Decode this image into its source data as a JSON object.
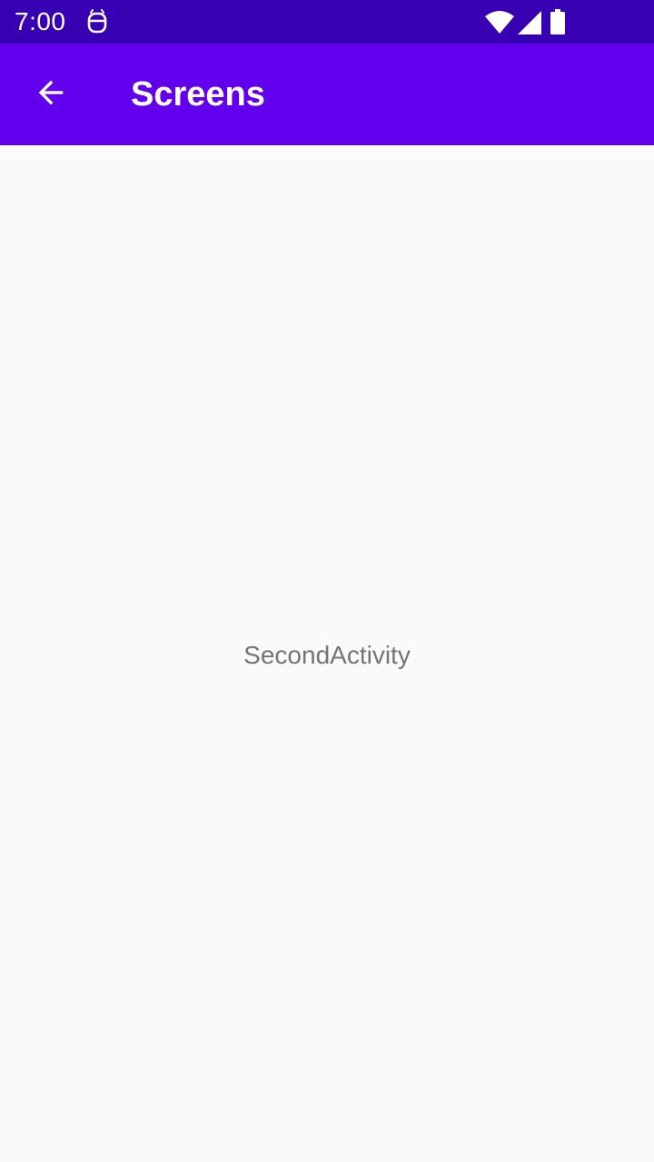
{
  "status_bar": {
    "time": "7:00",
    "background_color": "#3700b3",
    "icons": [
      "notification-app-icon",
      "wifi-icon",
      "signal-icon",
      "battery-icon"
    ]
  },
  "app_bar": {
    "title": "Screens",
    "background_color": "#6200ee",
    "back_icon": "arrow-back-icon"
  },
  "content": {
    "message": "SecondActivity"
  }
}
